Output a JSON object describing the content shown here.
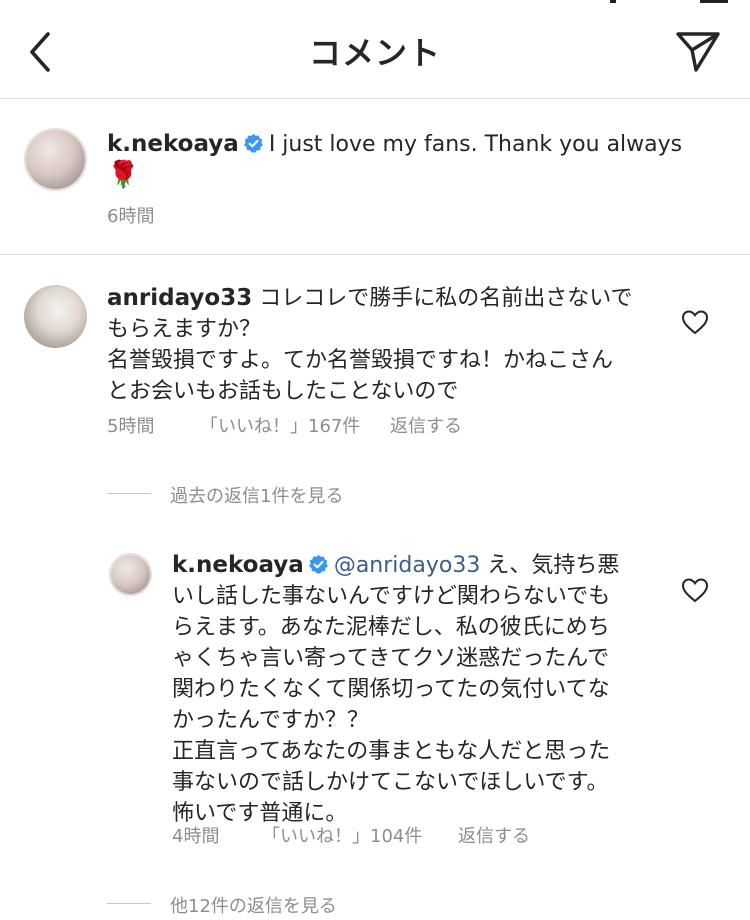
{
  "header": {
    "title": "コメント"
  },
  "post": {
    "username": "k.nekoaya",
    "text": "I just love my fans. Thank you always",
    "emoji": "🌹",
    "time": "6時間"
  },
  "comment1": {
    "username": "anridayo33",
    "text_line1": "コレコレで勝手に私の名前出さないで",
    "text_line2": "もらえますか？",
    "text_line3": "名誉毀損ですよ。てか名誉毀損ですね！かねこさん",
    "text_line4": "とお会いもお話もしたことないので",
    "time": "5時間",
    "likes": "「いいね！」167件",
    "reply": "返信する",
    "view_past_replies": "過去の返信1件を見る"
  },
  "reply1": {
    "username": "k.nekoaya",
    "mention": "@anridayo33",
    "line1_rest": " え、気持ち悪",
    "line2": "いし話した事ないんですけど関わらないでも",
    "line3": "らえます。あなた泥棒だし、私の彼氏にめち",
    "line4": "ゃくちゃ言い寄ってきてクソ迷惑だったんで",
    "line5": "関わりたくなくて関係切ってたの気付いてな",
    "line6": "かったんですか？？",
    "line7": "正直言ってあなたの事まともな人だと思った",
    "line8": "事ないので話しかけてこないでほしいです。",
    "line9": "怖いです普通に。",
    "time": "4時間",
    "likes": "「いいね！」104件",
    "reply": "返信する",
    "view_more_replies": "他12件の返信を見る"
  },
  "colors": {
    "verified_badge": "#3897f0",
    "text": "#262626",
    "meta": "#8e8e8e",
    "mention": "#3b5d8a",
    "divider": "#dbdbdb"
  },
  "icons": {
    "back": "chevron-left-icon",
    "send": "paper-plane-icon",
    "like": "heart-outline-icon",
    "verified": "verified-badge-icon"
  }
}
